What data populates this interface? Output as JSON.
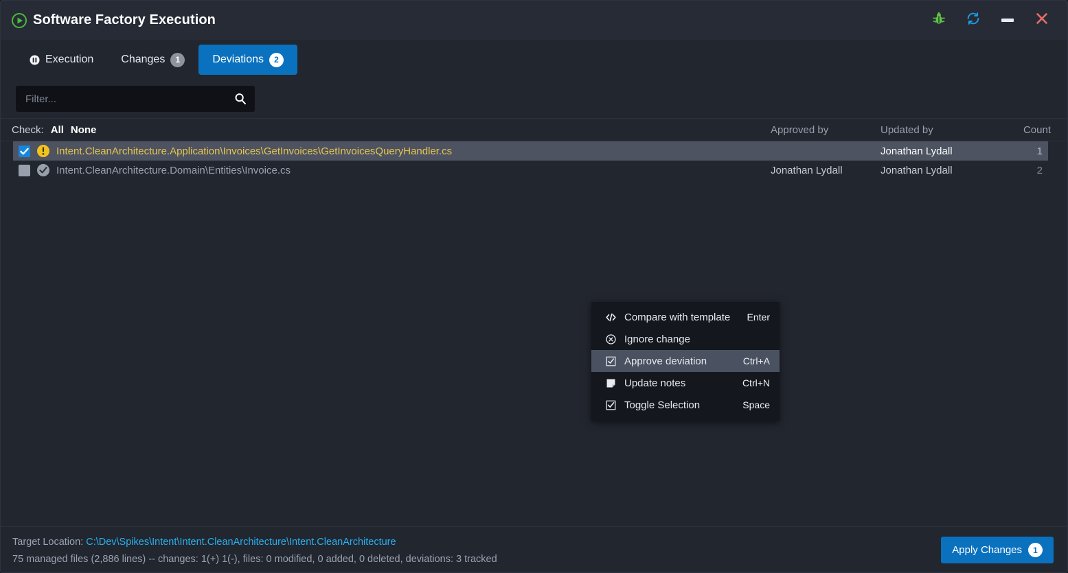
{
  "window": {
    "title": "Software Factory Execution",
    "app_icon": "play-circle-icon",
    "controls": {
      "debug_label": "bug-icon",
      "refresh_label": "refresh-icon",
      "minimize_label": "minimize-icon",
      "close_label": "close-icon"
    }
  },
  "tabs": [
    {
      "label": "Execution",
      "badge": "",
      "icon": "pause-circle-icon",
      "active": false
    },
    {
      "label": "Changes",
      "badge": "1",
      "icon": "",
      "active": false
    },
    {
      "label": "Deviations",
      "badge": "2",
      "icon": "",
      "active": true
    }
  ],
  "filter": {
    "value": "",
    "placeholder": "Filter...",
    "icon": "search-icon"
  },
  "check_bar": {
    "label": "Check:",
    "all": "All",
    "none": "None"
  },
  "columns": {
    "approved_by": "Approved by",
    "updated_by": "Updated by",
    "count": "Count"
  },
  "rows": [
    {
      "checked": true,
      "selected": true,
      "status_icon": "warning-icon",
      "filename": "Intent.CleanArchitecture.Application\\Invoices\\GetInvoices\\GetInvoicesQueryHandler.cs",
      "approved_by": "",
      "updated_by": "Jonathan Lydall",
      "count": "1"
    },
    {
      "checked": false,
      "selected": false,
      "status_icon": "check-circle-icon",
      "filename": "Intent.CleanArchitecture.Domain\\Entities\\Invoice.cs",
      "approved_by": "Jonathan Lydall",
      "updated_by": "Jonathan Lydall",
      "count": "2"
    }
  ],
  "context_menu": {
    "items": [
      {
        "icon": "code-icon",
        "label": "Compare with template",
        "shortcut": "Enter",
        "highlight": false
      },
      {
        "icon": "circle-x-icon",
        "label": "Ignore change",
        "shortcut": "",
        "highlight": false
      },
      {
        "icon": "checkbox-icon",
        "label": "Approve deviation",
        "shortcut": "Ctrl+A",
        "highlight": true
      },
      {
        "icon": "note-icon",
        "label": "Update notes",
        "shortcut": "Ctrl+N",
        "highlight": false
      },
      {
        "icon": "check-box-icon",
        "label": "Toggle Selection",
        "shortcut": "Space",
        "highlight": false
      }
    ]
  },
  "footer": {
    "target_location_label": "Target Location:",
    "target_location_path": "C:\\Dev\\Spikes\\Intent\\Intent.CleanArchitecture\\Intent.CleanArchitecture",
    "summary": "75 managed files (2,886 lines) -- changes: 1(+) 1(-), files: 0 modified, 0 added, 0 deleted, deviations: 3 tracked",
    "apply_label": "Apply Changes",
    "apply_badge": "1"
  },
  "colors": {
    "accent": "#0a71bf",
    "link": "#29b0f0",
    "warning": "#f0c020",
    "deviation_text": "#e9c54c",
    "close": "#e06c65",
    "bug": "#5fc34a",
    "refresh": "#1e9ae0"
  }
}
